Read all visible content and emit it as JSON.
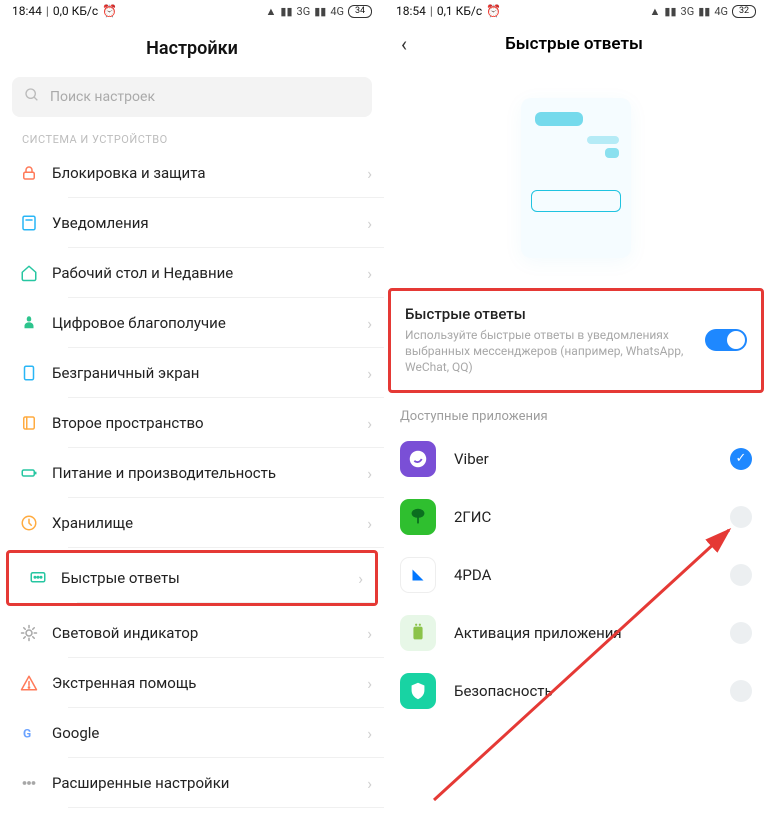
{
  "left": {
    "status": {
      "time": "18:44",
      "net": "0,0 КБ/с",
      "bars": "3G",
      "bars2": "4G",
      "battery": "34"
    },
    "header": "Настройки",
    "search_placeholder": "Поиск настроек",
    "section": "СИСТЕМА И УСТРОЙСТВО",
    "items": [
      {
        "icon": "lock-icon",
        "color": "#ff7a59",
        "label": "Блокировка и защита"
      },
      {
        "icon": "notif-icon",
        "color": "#29b6f6",
        "label": "Уведомления"
      },
      {
        "icon": "home-icon",
        "color": "#26c6a1",
        "label": "Рабочий стол и Недавние"
      },
      {
        "icon": "wellbeing-icon",
        "color": "#2dc48d",
        "label": "Цифровое благополучие"
      },
      {
        "icon": "screen-icon",
        "color": "#29b6f6",
        "label": "Безграничный экран"
      },
      {
        "icon": "space-icon",
        "color": "#ffab40",
        "label": "Второе пространство"
      },
      {
        "icon": "battery-icon",
        "color": "#26c6a1",
        "label": "Питание и производительность"
      },
      {
        "icon": "storage-icon",
        "color": "#ffab40",
        "label": "Хранилище"
      },
      {
        "icon": "quick-icon",
        "color": "#26c6a1",
        "label": "Быстрые ответы",
        "highlight": true
      },
      {
        "icon": "led-icon",
        "color": "#a7a7a7",
        "label": "Световой индикатор"
      },
      {
        "icon": "sos-icon",
        "color": "#ff7a59",
        "label": "Экстренная помощь"
      },
      {
        "icon": "google-icon",
        "color": "#6aa2ff",
        "label": "Google"
      },
      {
        "icon": "more-icon",
        "color": "#a7a7a7",
        "label": "Расширенные настройки"
      }
    ]
  },
  "right": {
    "status": {
      "time": "18:54",
      "net": "0,1 КБ/с",
      "bars": "3G",
      "bars2": "4G",
      "battery": "32"
    },
    "header": "Быстрые ответы",
    "toggle_card": {
      "title": "Быстрые ответы",
      "desc": "Используйте быстрые ответы в уведомлениях выбранных мессенджеров (например, WhatsApp, WeChat, QQ)",
      "on": true
    },
    "section": "Доступные приложения",
    "apps": [
      {
        "name": "Viber",
        "bg": "#7a4fd6",
        "checked": true
      },
      {
        "name": "2ГИС",
        "bg": "#2fbf2f",
        "checked": false
      },
      {
        "name": "4PDA",
        "bg": "#ffffff",
        "checked": false,
        "fg": "#0277ff",
        "brd": true
      },
      {
        "name": "Активация приложения",
        "bg": "#e7f7e7",
        "checked": false,
        "fg": "#6ab04c"
      },
      {
        "name": "Безопасность",
        "bg": "#18d3a3",
        "checked": false
      }
    ]
  }
}
